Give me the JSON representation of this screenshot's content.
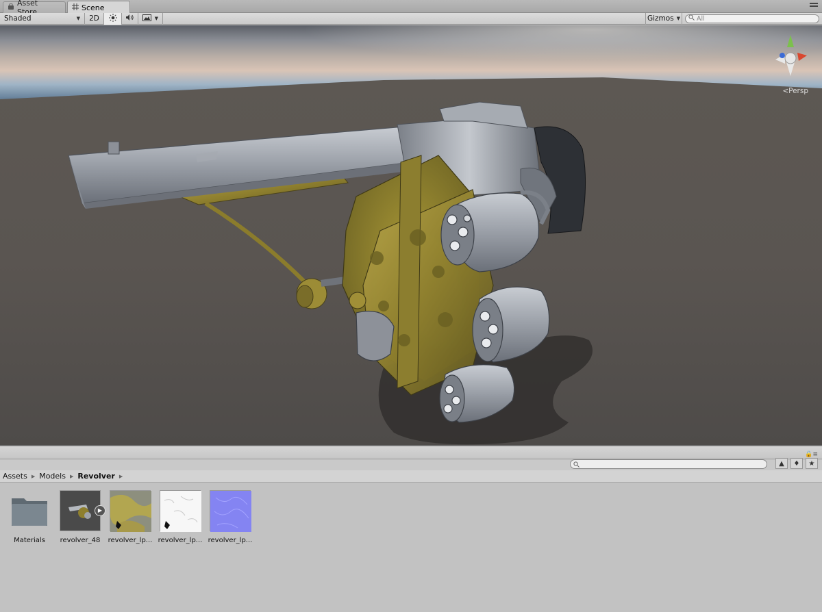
{
  "tabs": [
    {
      "label": "Asset Store",
      "icon": "shopping-bag-icon",
      "active": false
    },
    {
      "label": "Scene",
      "icon": "grid-icon",
      "active": true
    }
  ],
  "scene_toolbar": {
    "draw_mode": "Shaded",
    "mode_2d": "2D",
    "gizmos_label": "Gizmos",
    "search_placeholder": "All",
    "icons": [
      "sun-icon",
      "audio-icon",
      "image-effects-icon"
    ]
  },
  "scene": {
    "projection_label": "Persp",
    "object": "revolver model"
  },
  "project": {
    "breadcrumb": [
      "Assets",
      "Models",
      "Revolver"
    ],
    "assets": [
      {
        "label": "Materials",
        "type": "folder"
      },
      {
        "label": "revolver_48",
        "type": "model"
      },
      {
        "label": "revolver_lp...",
        "type": "texture-diffuse"
      },
      {
        "label": "revolver_lp...",
        "type": "texture-ao"
      },
      {
        "label": "revolver_lp...",
        "type": "texture-normal"
      }
    ]
  }
}
